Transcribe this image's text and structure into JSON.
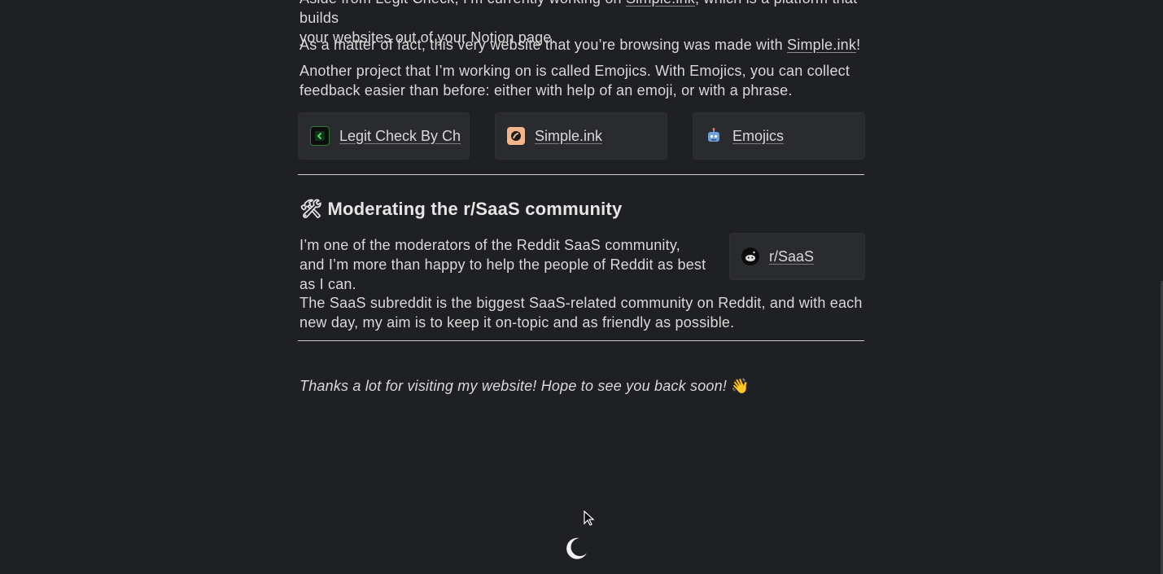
{
  "intro": {
    "line1_a": "Aside from Legit Check, I’m currently working on ",
    "line1_link": "Simple.ink",
    "line1_b": ", which is a platform that builds",
    "line2": "your websites out of your Notion page."
  },
  "matter": {
    "text": "As a matter of fact, this very website that you’re browsing was made with ",
    "link": "Simple.ink",
    "tail": "!"
  },
  "another": {
    "text": "Another project that I’m working on is called Emojics. With Emojics, you can collect feedback easier than before: either with help of an emoji, or with a phrase."
  },
  "cards": [
    {
      "label": "Legit Check By Ch",
      "icon": "legit-check-icon"
    },
    {
      "label": "Simple.ink",
      "icon": "simple-ink-icon"
    },
    {
      "label": "Emojics",
      "icon": "emojics-robot-icon"
    }
  ],
  "moderating": {
    "emoji": "🛠",
    "heading": "Moderating the r/SaaS community",
    "para1": "I’m one of the moderators of the Reddit SaaS community, and I’m more than happy to help the people of Reddit as best as I can.",
    "card_label": "r/SaaS",
    "card_icon": "reddit-icon",
    "para2": "The SaaS subreddit is the biggest SaaS-related community on Reddit, and with each new day, my aim is to keep it on-topic and as friendly as possible."
  },
  "thanks": {
    "text": "Thanks a lot for visiting my website! Hope to see you back soon! ",
    "emoji": "👋"
  },
  "icons": {
    "theme_toggle": "moon-icon",
    "cursor": "cursor-arrow-icon"
  },
  "colors": {
    "background": "#1f2023",
    "card": "#2a2b2e",
    "text": "#d9d9d9"
  }
}
